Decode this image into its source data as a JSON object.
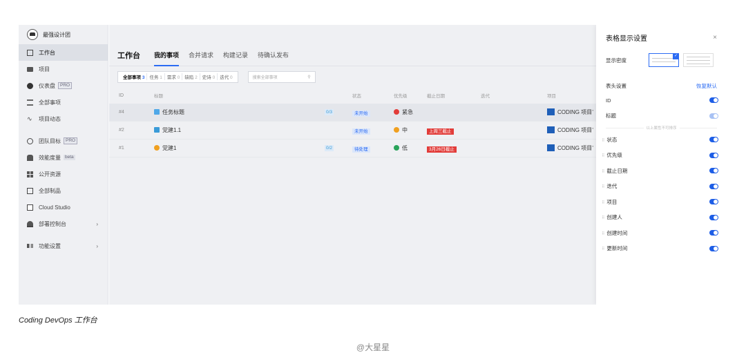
{
  "team_name": "最强设计团",
  "sidebar": {
    "items": [
      {
        "label": "工作台",
        "icon": "board-icon"
      },
      {
        "label": "项目",
        "icon": "folder-icon"
      },
      {
        "label": "仪表盘",
        "badge": "PRO",
        "icon": "dashboard-icon"
      },
      {
        "label": "全部事项",
        "icon": "list-icon"
      },
      {
        "label": "项目动态",
        "icon": "pulse-icon"
      },
      {
        "label": "团队目标",
        "badge": "PRO",
        "icon": "target-icon"
      },
      {
        "label": "效能度量",
        "badge": "beta",
        "icon": "people-icon"
      },
      {
        "label": "公开资源",
        "icon": "grid-icon"
      },
      {
        "label": "全部制品",
        "icon": "box-icon"
      },
      {
        "label": "Cloud Studio",
        "icon": "code-icon"
      },
      {
        "label": "部署控制台",
        "icon": "deploy-icon",
        "arrow": "›"
      },
      {
        "label": "功能设置",
        "icon": "settings-icon",
        "arrow": "›"
      }
    ]
  },
  "main": {
    "page_title": "工作台",
    "tabs": [
      "我的事项",
      "合并请求",
      "构建记录",
      "待确认发布"
    ],
    "filters": [
      {
        "label": "全部事项",
        "count": "3"
      },
      {
        "label": "任务",
        "count": "1"
      },
      {
        "label": "需求",
        "count": "0"
      },
      {
        "label": "缺陷",
        "count": "2"
      },
      {
        "label": "史诗",
        "count": "0"
      },
      {
        "label": "迭代",
        "count": "0"
      }
    ],
    "search_placeholder": "搜索全部事项",
    "columns": {
      "id": "ID",
      "title": "标题",
      "status": "状态",
      "priority": "优先级",
      "due": "截止日期",
      "iteration": "迭代",
      "project": "项目"
    },
    "rows": [
      {
        "id": "#4",
        "title": "任务标题",
        "sub": "0/3",
        "status": "未开始",
        "priority": "紧急",
        "due": "",
        "project": "CODING 项目’"
      },
      {
        "id": "#2",
        "title": "党建1.1",
        "sub": "",
        "status": "未开始",
        "priority": "中",
        "due": "上周三截止",
        "project": "CODING 项目’"
      },
      {
        "id": "#1",
        "title": "党建1",
        "sub": "0/2",
        "status": "待处理",
        "priority": "低",
        "due": "3月26日截止",
        "project": "CODING 项目’"
      }
    ]
  },
  "drawer": {
    "title": "表格显示设置",
    "close": "×",
    "density_label": "显示密度",
    "header_settings": "表头设置",
    "restore": "恢复默认",
    "fixed_columns": [
      "ID",
      "标题"
    ],
    "divider_text": "以上属性不可排序",
    "columns": [
      "状态",
      "优先级",
      "截止日期",
      "迭代",
      "项目",
      "创建人",
      "创建时间",
      "更新时间"
    ]
  },
  "caption": "Coding DevOps 工作台",
  "credit": "@大星星",
  "colors": {
    "accent": "#2b6bf3",
    "danger": "#e23c39",
    "sidebar_bg": "#eff0f3"
  }
}
